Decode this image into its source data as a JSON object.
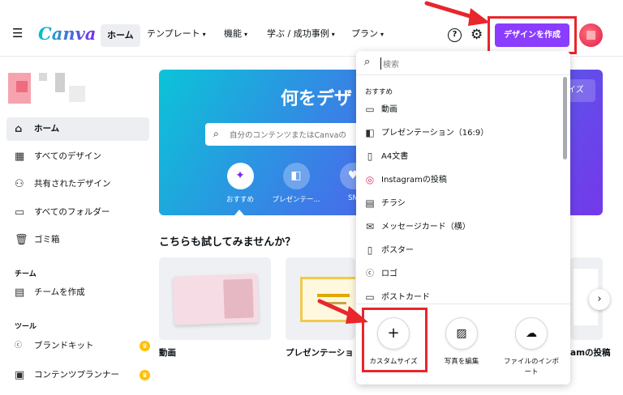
{
  "header": {
    "logo": "Canva",
    "nav": [
      {
        "label": "ホーム"
      },
      {
        "label": "テンプレート"
      },
      {
        "label": "機能"
      },
      {
        "label": "学ぶ / 成功事例"
      },
      {
        "label": "プラン"
      }
    ],
    "help_symbol": "?",
    "create_button": "デザインを作成"
  },
  "sidebar": {
    "items": [
      {
        "label": "ホーム",
        "icon": "home-icon"
      },
      {
        "label": "すべてのデザイン",
        "icon": "grid-icon"
      },
      {
        "label": "共有されたデザイン",
        "icon": "users-icon"
      },
      {
        "label": "すべてのフォルダー",
        "icon": "folder-icon"
      },
      {
        "label": "ゴミ箱",
        "icon": "trash-icon"
      }
    ],
    "team_section": "チーム",
    "team_items": [
      {
        "label": "チームを作成",
        "icon": "building-icon"
      }
    ],
    "tools_section": "ツール",
    "tool_items": [
      {
        "label": "ブランドキット",
        "icon": "brand-co-icon"
      },
      {
        "label": "コンテンツプランナー",
        "icon": "calendar-icon"
      }
    ]
  },
  "banner": {
    "title": "何をデザ",
    "size_button": "イズ",
    "search_placeholder": "自分のコンテンツまたはCanvaの",
    "categories": [
      {
        "label": "おすすめ",
        "icon": "sparkle-icon"
      },
      {
        "label": "プレゼンテー...",
        "icon": "presentation-icon"
      },
      {
        "label": "SN",
        "icon": "heart-icon"
      }
    ]
  },
  "try_section": {
    "title": "こちらも試してみませんか？",
    "cards": [
      {
        "label": "動画"
      },
      {
        "label": "プレゼンテーショ"
      },
      {
        "label": "amの投稿"
      }
    ]
  },
  "dropdown": {
    "search_placeholder": "検索",
    "section": "おすすめ",
    "items": [
      {
        "label": "動画",
        "icon": "video-icon"
      },
      {
        "label": "プレゼンテーション（16:9）",
        "icon": "presentation-icon"
      },
      {
        "label": "A4文書",
        "icon": "document-icon"
      },
      {
        "label": "Instagramの投稿",
        "icon": "instagram-icon"
      },
      {
        "label": "チラシ",
        "icon": "flyer-icon"
      },
      {
        "label": "メッセージカード（横）",
        "icon": "envelope-icon"
      },
      {
        "label": "ポスター",
        "icon": "poster-icon"
      },
      {
        "label": "ロゴ",
        "icon": "logo-co-icon"
      },
      {
        "label": "ポストカード",
        "icon": "postcard-icon"
      }
    ],
    "bottom": [
      {
        "label": "カスタムサイズ",
        "icon": "plus-icon"
      },
      {
        "label": "写真を編集",
        "icon": "image-edit-icon"
      },
      {
        "label": "ファイルのインポート",
        "icon": "upload-icon"
      }
    ]
  },
  "colors": {
    "accent": "#8b3dff",
    "highlight": "#e8262b"
  }
}
